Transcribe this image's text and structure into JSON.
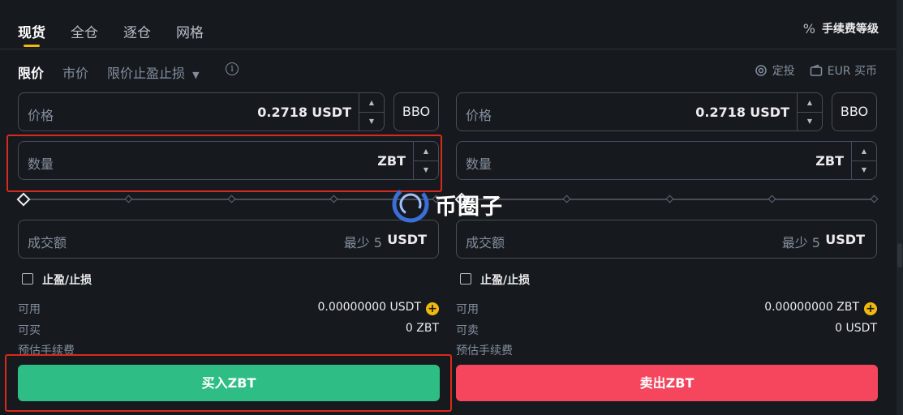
{
  "tabs": [
    "现货",
    "全仓",
    "逐仓",
    "网格"
  ],
  "fee_level": {
    "icon": "percent-icon",
    "label": "手续费等级"
  },
  "order_types": [
    "限价",
    "市价",
    "限价止盈止损"
  ],
  "right_links": [
    {
      "icon": "recurring-icon",
      "label": "定投"
    },
    {
      "icon": "wallet-icon",
      "label": "EUR 买币"
    }
  ],
  "buy": {
    "price": {
      "label": "价格",
      "value": "0.2718",
      "unit": "USDT"
    },
    "bbo": "BBO",
    "amount": {
      "label": "数量",
      "unit": "ZBT"
    },
    "total": {
      "label": "成交额",
      "hint": "最少 5",
      "unit": "USDT"
    },
    "tpsl": "止盈/止损",
    "available": {
      "label": "可用",
      "value": "0.00000000 USDT"
    },
    "max": {
      "label": "可买",
      "value": "0 ZBT"
    },
    "fee": {
      "label": "预估手续费"
    },
    "button": "买入ZBT"
  },
  "sell": {
    "price": {
      "label": "价格",
      "value": "0.2718",
      "unit": "USDT"
    },
    "bbo": "BBO",
    "amount": {
      "label": "数量",
      "unit": "ZBT"
    },
    "total": {
      "label": "成交额",
      "hint": "最少 5",
      "unit": "USDT"
    },
    "tpsl": "止盈/止损",
    "available": {
      "label": "可用",
      "value": "0.00000000 ZBT"
    },
    "max": {
      "label": "可卖",
      "value": "0 USDT"
    },
    "fee": {
      "label": "预估手续费"
    },
    "button": "卖出ZBT"
  },
  "slider": {
    "buy_percent": 0,
    "sell_percent": 0
  },
  "watermark": "币圈子",
  "colors": {
    "buy": "#2ebd85",
    "sell": "#f6465d",
    "accent": "#f0b90b",
    "highlight": "#d9291c"
  }
}
